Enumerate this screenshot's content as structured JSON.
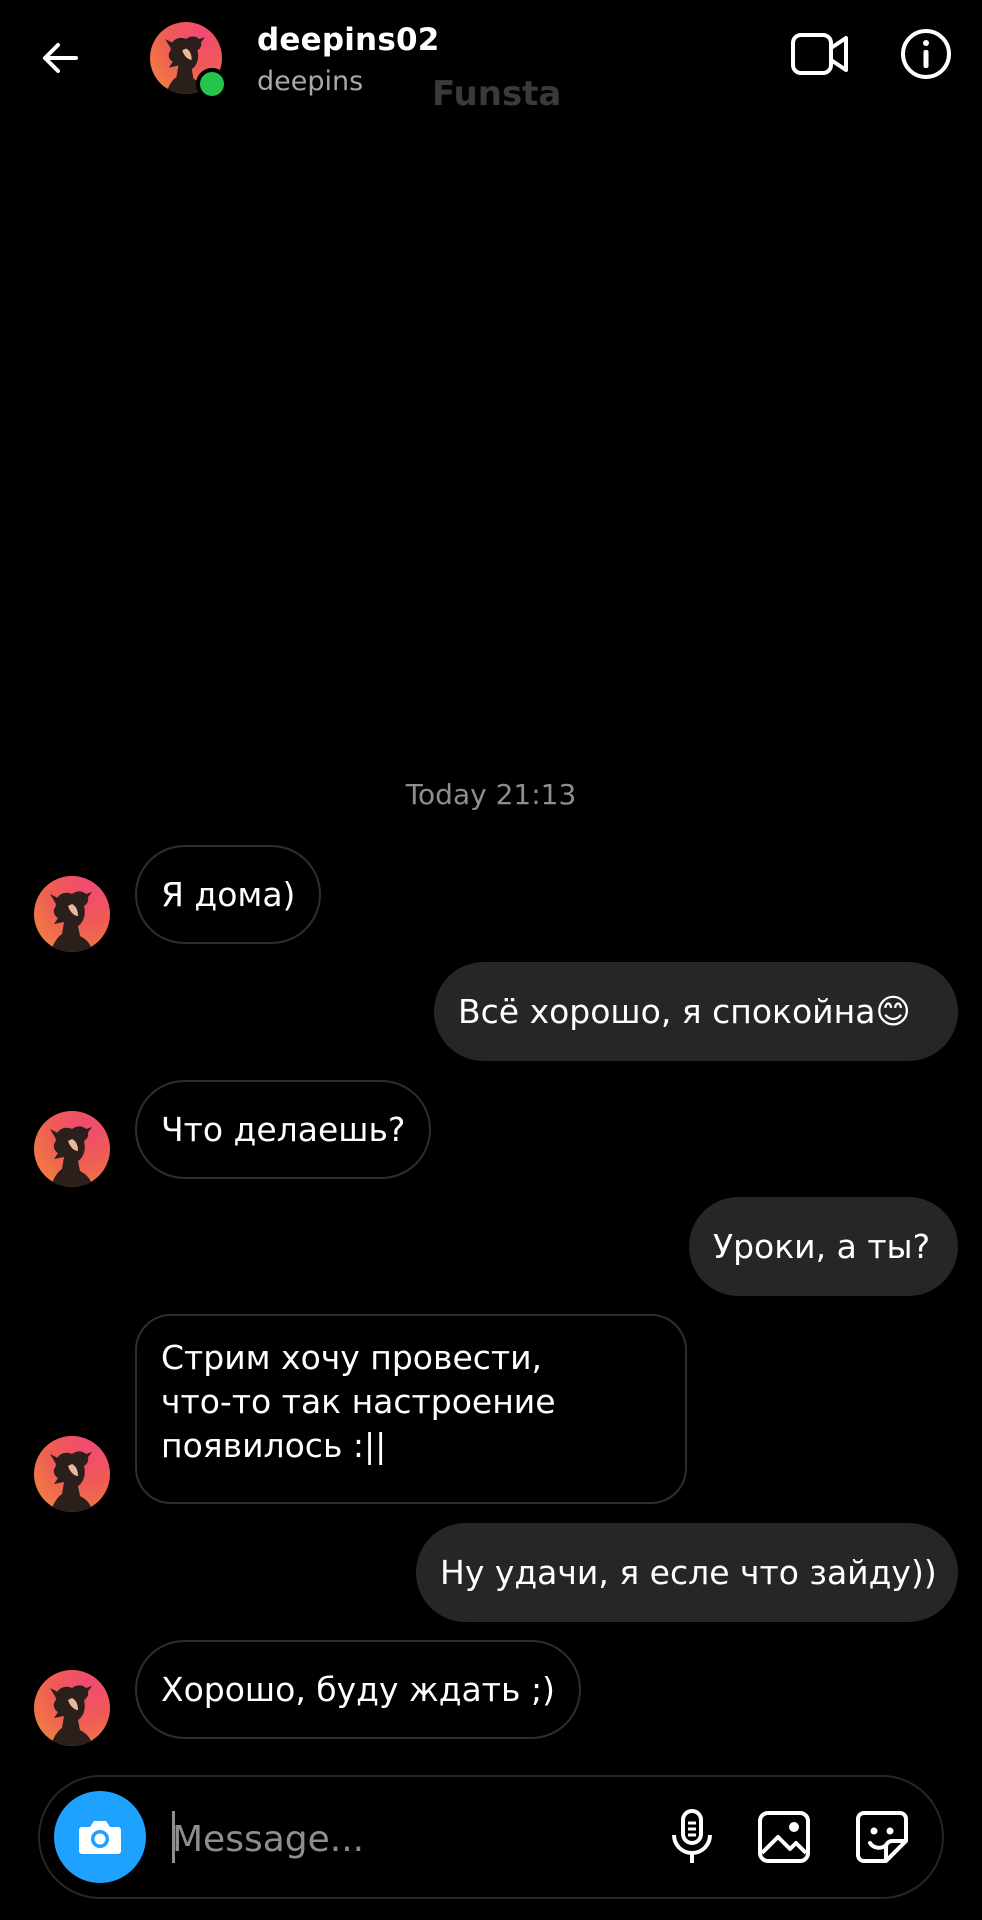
{
  "header": {
    "username": "deepins02",
    "subname": "deepins",
    "watermark": "Funsta"
  },
  "timestamp": "Today 21:13",
  "messages": [
    {
      "from": "them",
      "text": "Я дома)"
    },
    {
      "from": "me",
      "text": "Всё хорошо, я спокойна",
      "emoji": "😊"
    },
    {
      "from": "them",
      "text": "Что делаешь?"
    },
    {
      "from": "me",
      "text": "Уроки, а ты?"
    },
    {
      "from": "them",
      "lines": [
        "Стрим хочу провести,",
        "что-то так настроение",
        "появилось :||"
      ]
    },
    {
      "from": "me",
      "text": "Ну удачи, я есле что зайду))"
    },
    {
      "from": "them",
      "text": "Хорошо, буду ждать ;)"
    }
  ],
  "composer": {
    "placeholder": "Message..."
  },
  "colors": {
    "background": "#000000",
    "outgoing_bubble": "#262626",
    "incoming_border": "#2e2e2e",
    "online": "#27c44d",
    "camera_button": "#1fa1ff",
    "secondary_text": "#8e8e8e"
  },
  "icons": [
    "back-arrow-icon",
    "video-call-icon",
    "info-icon",
    "camera-icon",
    "microphone-icon",
    "gallery-icon",
    "sticker-icon"
  ]
}
